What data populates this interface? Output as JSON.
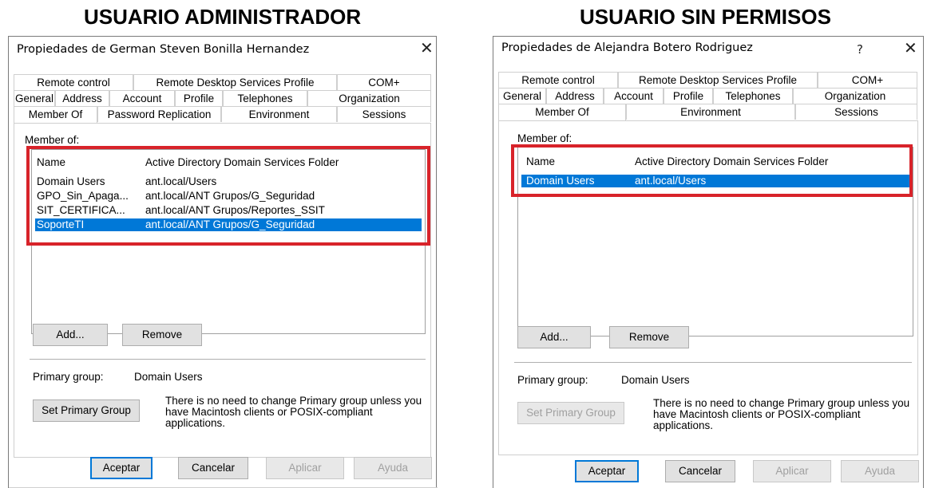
{
  "headings": {
    "left": "USUARIO ADMINISTRADOR",
    "right": "USUARIO SIN PERMISOS"
  },
  "colors": {
    "highlight": "#d8232a",
    "selection": "#0078d7"
  },
  "left_dialog": {
    "title": "Propiedades de German Steven Bonilla Hernandez",
    "close_glyph": "✕",
    "tabs_row1": [
      "Remote control",
      "Remote Desktop Services Profile",
      "COM+"
    ],
    "tabs_row2": [
      "General",
      "Address",
      "Account",
      "Profile",
      "Telephones",
      "Organization"
    ],
    "tabs_row3": [
      "Member Of",
      "Password Replication",
      "Environment",
      "Sessions"
    ],
    "member_of_label": "Member of:",
    "columns": [
      "Name",
      "Active Directory Domain Services Folder"
    ],
    "rows": [
      {
        "name": "Domain Users",
        "folder": "ant.local/Users"
      },
      {
        "name": "GPO_Sin_Apaga...",
        "folder": "ant.local/ANT Grupos/G_Seguridad"
      },
      {
        "name": "SIT_CERTIFICA...",
        "folder": "ant.local/ANT Grupos/Reportes_SSIT"
      },
      {
        "name": "SoporteTI",
        "folder": "ant.local/ANT Grupos/G_Seguridad"
      }
    ],
    "add_label": "Add...",
    "remove_label": "Remove",
    "primary_group_label": "Primary group:",
    "primary_group_value": "Domain Users",
    "set_primary_label": "Set Primary Group",
    "note": "There is no need to change Primary group unless you have Macintosh clients or POSIX-compliant applications.",
    "ok_label": "Aceptar",
    "cancel_label": "Cancelar",
    "apply_label": "Aplicar",
    "help_label": "Ayuda"
  },
  "right_dialog": {
    "title": "Propiedades de Alejandra Botero Rodriguez",
    "help_glyph": "?",
    "close_glyph": "✕",
    "tabs_row1": [
      "Remote control",
      "Remote Desktop Services Profile",
      "COM+"
    ],
    "tabs_row2": [
      "General",
      "Address",
      "Account",
      "Profile",
      "Telephones",
      "Organization"
    ],
    "tabs_row3": [
      "Member Of",
      "Environment",
      "Sessions"
    ],
    "member_of_label": "Member of:",
    "columns": [
      "Name",
      "Active Directory Domain Services Folder"
    ],
    "rows": [
      {
        "name": "Domain Users",
        "folder": "ant.local/Users"
      }
    ],
    "add_label": "Add...",
    "remove_label": "Remove",
    "primary_group_label": "Primary group:",
    "primary_group_value": "Domain Users",
    "set_primary_label": "Set Primary Group",
    "note": "There is no need to change Primary group unless you have Macintosh clients or POSIX-compliant applications.",
    "ok_label": "Aceptar",
    "cancel_label": "Cancelar",
    "apply_label": "Aplicar",
    "help_label": "Ayuda"
  }
}
